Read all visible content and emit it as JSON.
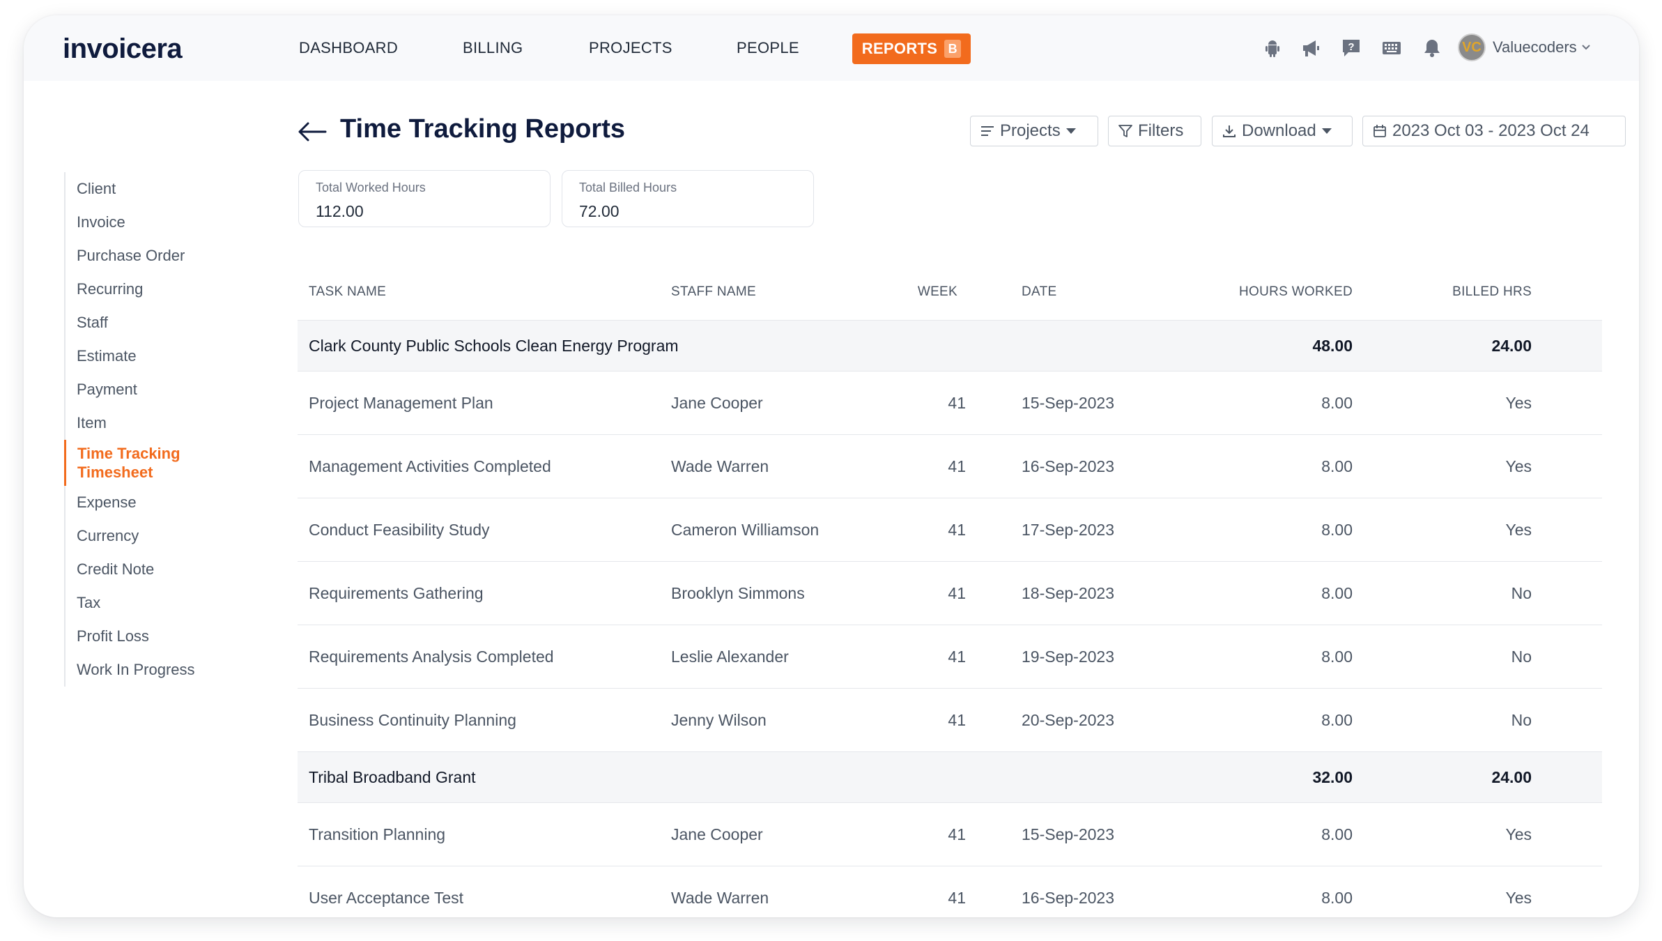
{
  "app": {
    "logo": "invoicera"
  },
  "nav": {
    "items": [
      "DASHBOARD",
      "BILLING",
      "PROJECTS",
      "PEOPLE"
    ],
    "active": "REPORTS",
    "active_badge": "B"
  },
  "top_icons": [
    "android-icon",
    "megaphone-icon",
    "help-icon",
    "keyboard-icon",
    "bell-icon"
  ],
  "user": {
    "initials": "VC",
    "name": "Valuecoders"
  },
  "sidebar": {
    "items": [
      "Client",
      "Invoice",
      "Purchase Order",
      "Recurring",
      "Staff",
      "Estimate",
      "Payment",
      "Item",
      "Time Tracking Timesheet",
      "Expense",
      "Currency",
      "Credit Note",
      "Tax",
      "Profit Loss",
      "Work In Progress"
    ],
    "active_line1": "Time Tracking",
    "active_line2": "Timesheet"
  },
  "page": {
    "title": "Time Tracking Reports"
  },
  "controls": {
    "projects": "Projects",
    "filters": "Filters",
    "download": "Download",
    "date_range": "2023 Oct 03 - 2023 Oct 24"
  },
  "stats": {
    "worked_label": "Total Worked Hours",
    "worked_value": "112.00",
    "billed_label": "Total Billed Hours",
    "billed_value": "72.00"
  },
  "table": {
    "headers": [
      "TASK NAME",
      "STAFF NAME",
      "WEEK",
      "DATE",
      "HOURS WORKED",
      "BILLED HRS"
    ],
    "groups": [
      {
        "name": "Clark County Public Schools Clean Energy Program",
        "hours": "48.00",
        "billed": "24.00",
        "rows": [
          {
            "task": "Project Management Plan",
            "staff": "Jane Cooper",
            "week": "41",
            "date": "15-Sep-2023",
            "hours": "8.00",
            "billed": "Yes"
          },
          {
            "task": "Management Activities Completed",
            "staff": "Wade Warren",
            "week": "41",
            "date": "16-Sep-2023",
            "hours": "8.00",
            "billed": "Yes"
          },
          {
            "task": "Conduct Feasibility Study",
            "staff": "Cameron Williamson",
            "week": "41",
            "date": "17-Sep-2023",
            "hours": "8.00",
            "billed": "Yes"
          },
          {
            "task": "Requirements Gathering",
            "staff": "Brooklyn Simmons",
            "week": "41",
            "date": "18-Sep-2023",
            "hours": "8.00",
            "billed": "No"
          },
          {
            "task": "Requirements Analysis Completed",
            "staff": "Leslie Alexander",
            "week": "41",
            "date": "19-Sep-2023",
            "hours": "8.00",
            "billed": "No"
          },
          {
            "task": "Business Continuity Planning",
            "staff": "Jenny Wilson",
            "week": "41",
            "date": "20-Sep-2023",
            "hours": "8.00",
            "billed": "No"
          }
        ]
      },
      {
        "name": "Tribal Broadband Grant",
        "hours": "32.00",
        "billed": "24.00",
        "rows": [
          {
            "task": "Transition Planning",
            "staff": "Jane Cooper",
            "week": "41",
            "date": "15-Sep-2023",
            "hours": "8.00",
            "billed": "Yes"
          },
          {
            "task": "User Acceptance Test",
            "staff": "Wade Warren",
            "week": "41",
            "date": "16-Sep-2023",
            "hours": "8.00",
            "billed": "Yes"
          }
        ]
      }
    ]
  },
  "colors": {
    "accent": "#f26b1d",
    "title": "#0f1b3d",
    "group_row_bg": "#f5f6f8"
  }
}
